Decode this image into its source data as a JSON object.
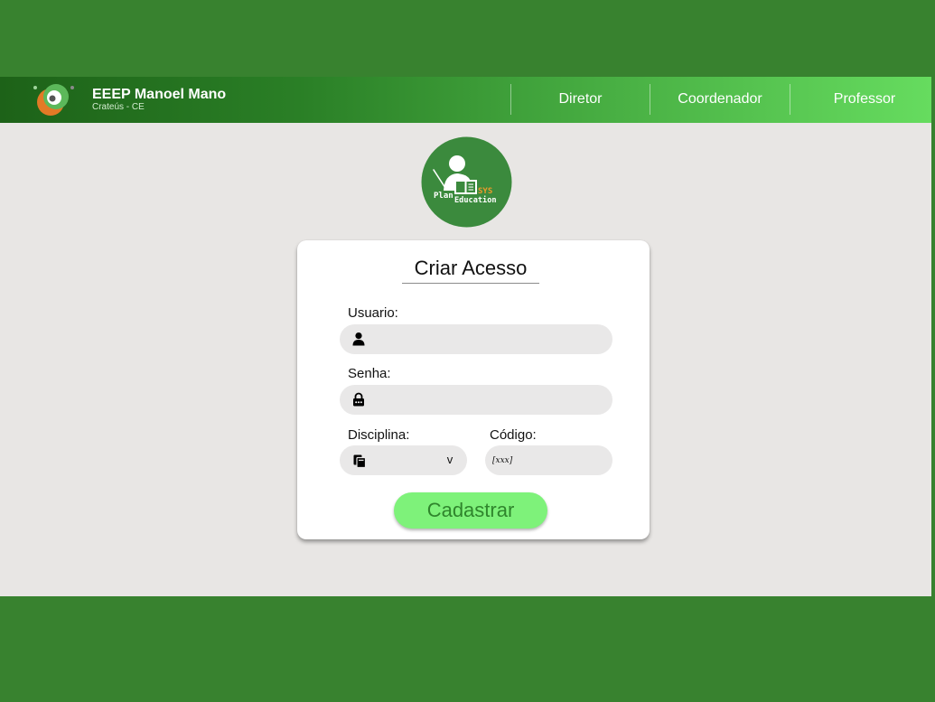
{
  "colors": {
    "page_green": "#38822f",
    "header_dark": "#1d6218",
    "header_light": "#66dc5f",
    "content_gray": "#e8e6e4",
    "logo_green": "#3b8a3d",
    "field_gray": "#e9e8e8",
    "button_green": "#7ef27a",
    "button_text": "#2f852c",
    "accent_orange": "#ec9a2c"
  },
  "header": {
    "school_name": "EEEP Manoel Mano",
    "school_location": "Crateús - CE",
    "logo_icon": "school-logo-icon",
    "nav": [
      {
        "label": "Diretor"
      },
      {
        "label": "Coordenador"
      },
      {
        "label": "Professor"
      }
    ]
  },
  "app_logo": {
    "icon": "teacher-icon",
    "word_plan": "Plan",
    "word_sys": "SYS",
    "word_education": "Education"
  },
  "form": {
    "title": "Criar Acesso",
    "usuario": {
      "label": "Usuario:",
      "value": "",
      "icon": "user-icon"
    },
    "senha": {
      "label": "Senha:",
      "value": "",
      "icon": "lock-icon"
    },
    "disciplina": {
      "label": "Disciplina:",
      "value": "",
      "icon": "books-icon",
      "caret": "v"
    },
    "codigo": {
      "label": "Código:",
      "value": "",
      "icon": "code-icon",
      "icon_glyph": "[xxx]"
    },
    "submit_label": "Cadastrar"
  }
}
